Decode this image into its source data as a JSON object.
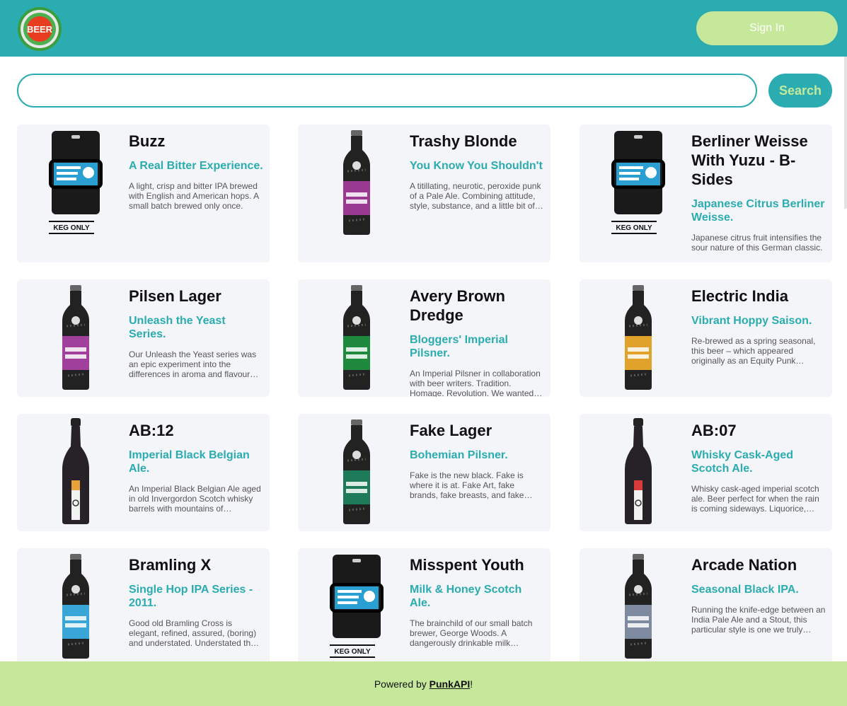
{
  "header": {
    "logo_text": "BEER",
    "signin_label": "Sign In"
  },
  "search": {
    "placeholder": "",
    "value": "",
    "button_label": "Search"
  },
  "colors": {
    "primary": "#2aacb0",
    "accent": "#c6e89a",
    "card_bg": "#f4f5f9"
  },
  "beers": [
    {
      "name": "Buzz",
      "tagline": "A Real Bitter Experience.",
      "description": "A light, crisp and bitter IPA brewed with English and American hops. A small batch brewed only once.",
      "image": "keg",
      "keg_label": "KEG ONLY",
      "label_color": "#2a9fd1"
    },
    {
      "name": "Trashy Blonde",
      "tagline": "You Know You Shouldn't",
      "description": "A titillating, neurotic, peroxide punk of a Pale Ale. Combining attitude, style, substance, and a little bit of…",
      "image": "bottle",
      "label_color": "#9b3a93"
    },
    {
      "name": "Berliner Weisse With Yuzu - B-Sides",
      "tagline": "Japanese Citrus Berliner Weisse.",
      "description": "Japanese citrus fruit intensifies the sour nature of this German classic.",
      "image": "keg",
      "keg_label": "KEG ONLY",
      "label_color": "#2a9fd1"
    },
    {
      "name": "Pilsen Lager",
      "tagline": "Unleash the Yeast Series.",
      "description": "Our Unleash the Yeast series was an epic experiment into the differences in aroma and flavour…",
      "image": "bottle",
      "label_color": "#a03f9c"
    },
    {
      "name": "Avery Brown Dredge",
      "tagline": "Bloggers' Imperial Pilsner.",
      "description": "An Imperial Pilsner in collaboration with beer writers. Tradition. Homage. Revolution. We wanted t…",
      "image": "bottle",
      "label_color": "#1f8a3e"
    },
    {
      "name": "Electric India",
      "tagline": "Vibrant Hoppy Saison.",
      "description": "Re-brewed as a spring seasonal, this beer – which appeared originally as an Equity Punk…",
      "image": "bottle",
      "label_color": "#e0a22a"
    },
    {
      "name": "AB:12",
      "tagline": "Imperial Black Belgian Ale.",
      "description": "An Imperial Black Belgian Ale aged in old Invergordon Scotch whisky barrels with mountains of…",
      "image": "tall",
      "label_color": "#e8a23a"
    },
    {
      "name": "Fake Lager",
      "tagline": "Bohemian Pilsner.",
      "description": "Fake is the new black. Fake is where it is at. Fake Art, fake brands, fake breasts, and fake lager. We…",
      "image": "bottle",
      "label_color": "#1d7a5a"
    },
    {
      "name": "AB:07",
      "tagline": "Whisky Cask-Aged Scotch Ale.",
      "description": "Whisky cask-aged imperial scotch ale. Beer perfect for when the rain is coming sideways. Liquorice,…",
      "image": "tall",
      "label_color": "#d93a3a"
    },
    {
      "name": "Bramling X",
      "tagline": "Single Hop IPA Series - 2011.",
      "description": "Good old Bramling Cross is elegant, refined, assured, (boring) and understated. Understated that is…",
      "image": "bottle",
      "label_color": "#3aa6d8"
    },
    {
      "name": "Misspent Youth",
      "tagline": "Milk & Honey Scotch Ale.",
      "description": "The brainchild of our small batch brewer, George Woods. A dangerously drinkable milk sugar-…",
      "image": "keg",
      "keg_label": "KEG ONLY",
      "label_color": "#2a9fd1"
    },
    {
      "name": "Arcade Nation",
      "tagline": "Seasonal Black IPA.",
      "description": "Running the knife-edge between an India Pale Ale and a Stout, this particular style is one we truly love…",
      "image": "bottle",
      "label_color": "#7d8aa0"
    }
  ],
  "footer": {
    "prefix": "Powered by ",
    "link_label": "PunkAPI",
    "suffix": "!"
  }
}
